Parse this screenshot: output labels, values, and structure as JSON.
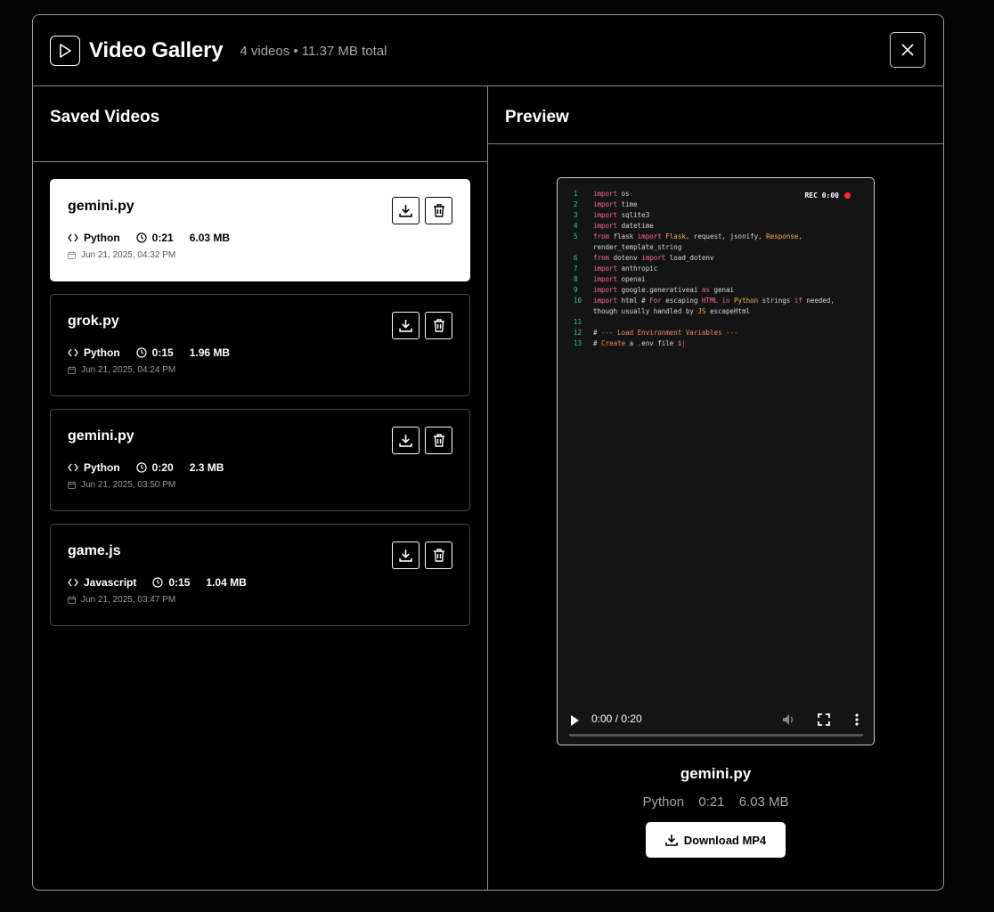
{
  "header": {
    "title": "Video Gallery",
    "summary": "4 videos • 11.37 MB total"
  },
  "left_pane": {
    "title": "Saved Videos"
  },
  "right_pane": {
    "title": "Preview"
  },
  "videos": [
    {
      "name": "gemini.py",
      "language": "Python",
      "duration": "0:21",
      "size": "6.03 MB",
      "date": "Jun 21, 2025, 04:32 PM",
      "selected": true
    },
    {
      "name": "grok.py",
      "language": "Python",
      "duration": "0:15",
      "size": "1.96 MB",
      "date": "Jun 21, 2025, 04:24 PM",
      "selected": false
    },
    {
      "name": "gemini.py",
      "language": "Python",
      "duration": "0:20",
      "size": "2.3 MB",
      "date": "Jun 21, 2025, 03:50 PM",
      "selected": false
    },
    {
      "name": "game.js",
      "language": "Javascript",
      "duration": "0:15",
      "size": "1.04 MB",
      "date": "Jun 21, 2025, 03:47 PM",
      "selected": false
    }
  ],
  "player": {
    "rec_label": "REC 0:00",
    "time": "0:00 / 0:20",
    "progress_fraction": 0,
    "code_lines": [
      {
        "no": "1",
        "html": "<span class='kw'>import</span> os"
      },
      {
        "no": "2",
        "html": "<span class='kw'>import</span> time"
      },
      {
        "no": "3",
        "html": "<span class='kw'>import</span> sqlite3"
      },
      {
        "no": "4",
        "html": "<span class='kw'>import</span> datetime"
      },
      {
        "no": "5",
        "html": "<span class='kw'>from</span> flask <span class='kw'>import</span> <span class='cls'>Flask</span>, request, jsonify, <span class='cls'>Response</span>,"
      },
      {
        "no": "",
        "html": "render_template_string"
      },
      {
        "no": "6",
        "html": "<span class='kw'>from</span> dotenv <span class='kw'>import</span> load_dotenv"
      },
      {
        "no": "7",
        "html": "<span class='kw'>import</span> anthropic"
      },
      {
        "no": "8",
        "html": "<span class='kw'>import</span> openai"
      },
      {
        "no": "9",
        "html": "<span class='kw'>import</span> google.generativeai <span class='kw'>as</span> genai"
      },
      {
        "no": "10",
        "html": "<span class='kw'>import</span> html # <span class='kw'>For</span> escaping <span class='kw'>HTML</span> <span class='kw'>in</span> <span class='cls'>Python</span> strings <span class='kw'>if</span> needed,"
      },
      {
        "no": "",
        "html": "though usually handled by <span class='cls'>JS</span> escapeHtml"
      },
      {
        "no": "11",
        "html": ""
      },
      {
        "no": "12",
        "html": "# <span class='cm'>--- Load Environment Variables ---</span>"
      },
      {
        "no": "13",
        "html": "# <span class='cm'>Create</span> a .env file i<span style='color:#ff4a7a'>|</span>"
      }
    ]
  },
  "preview": {
    "name": "gemini.py",
    "language": "Python",
    "duration": "0:21",
    "size": "6.03 MB",
    "download_label": "Download MP4"
  },
  "colors": {
    "accent_rec": "#ff2a2a",
    "line_number": "#3fc3ad",
    "keyword": "#ff6b9c",
    "class": "#ffb04a"
  }
}
